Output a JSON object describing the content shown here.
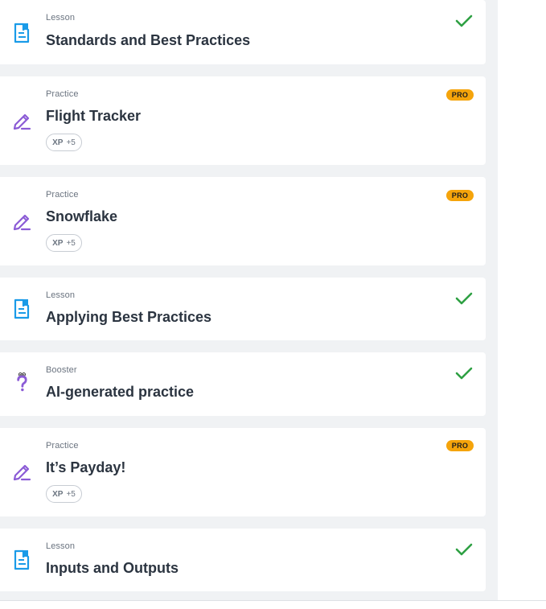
{
  "items": [
    {
      "type": "Lesson",
      "title": "Standards and Best Practices",
      "icon": "lesson-icon",
      "completed": true
    },
    {
      "type": "Practice",
      "title": "Flight Tracker",
      "icon": "practice-icon",
      "pro": "PRO",
      "xp_label": "XP",
      "xp_value": "+5"
    },
    {
      "type": "Practice",
      "title": "Snowflake",
      "icon": "practice-icon",
      "pro": "PRO",
      "xp_label": "XP",
      "xp_value": "+5"
    },
    {
      "type": "Lesson",
      "title": "Applying Best Practices",
      "icon": "lesson-icon",
      "completed": true
    },
    {
      "type": "Booster",
      "title": "AI-generated practice",
      "icon": "booster-icon",
      "completed": true
    },
    {
      "type": "Practice",
      "title": "It’s Payday!",
      "icon": "practice-icon",
      "pro": "PRO",
      "xp_label": "XP",
      "xp_value": "+5"
    },
    {
      "type": "Lesson",
      "title": "Inputs and Outputs",
      "icon": "lesson-icon",
      "completed": true
    }
  ],
  "colors": {
    "lesson_icon": "#1a9be8",
    "practice_icon": "#8b5bd6",
    "check": "#2ea043",
    "pro_badge": "#f5a40b"
  }
}
